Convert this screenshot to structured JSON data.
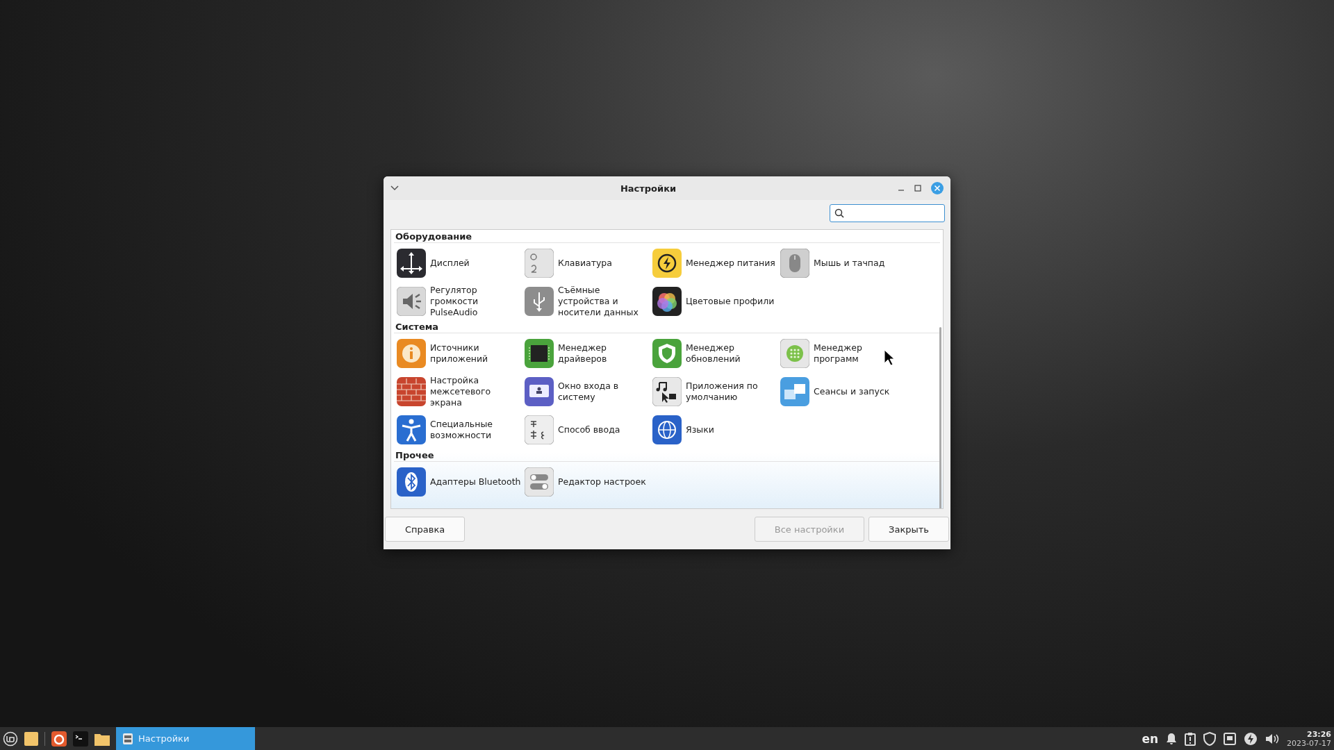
{
  "window": {
    "title": "Настройки"
  },
  "sections": [
    {
      "title": "Оборудование",
      "items": [
        {
          "label": "Дисплей"
        },
        {
          "label": "Клавиатура"
        },
        {
          "label": "Менеджер питания"
        },
        {
          "label": "Мышь и тачпад"
        },
        {
          "label": "Регулятор\nгромкости\nPulseAudio"
        },
        {
          "label": "Съёмные\nустройства и\nносители данных"
        },
        {
          "label": "Цветовые профили"
        }
      ]
    },
    {
      "title": "Система",
      "items": [
        {
          "label": "Источники\nприложений"
        },
        {
          "label": "Менеджер\nдрайверов"
        },
        {
          "label": "Менеджер\nобновлений"
        },
        {
          "label": "Менеджер\nпрограмм"
        },
        {
          "label": "Настройка\nмежсетевого\nэкрана"
        },
        {
          "label": "Окно входа в\nсистему"
        },
        {
          "label": "Приложения по\nумолчанию"
        },
        {
          "label": "Сеансы и запуск"
        },
        {
          "label": "Специальные\nвозможности"
        },
        {
          "label": "Способ ввода"
        },
        {
          "label": "Языки"
        }
      ]
    },
    {
      "title": "Прочее",
      "items": [
        {
          "label": "Адаптеры Bluetooth"
        },
        {
          "label": "Редактор настроек"
        }
      ]
    }
  ],
  "buttons": [
    {
      "label": "Справка",
      "disabled": false
    },
    {
      "label": "Все настройки",
      "disabled": true
    },
    {
      "label": "Закрыть",
      "disabled": false
    }
  ],
  "taskbar": {
    "window_button": {
      "label": "Настройки",
      "selected": true
    },
    "keyboard_layout": "en",
    "time": "23:26",
    "date": "2023-07-17"
  }
}
